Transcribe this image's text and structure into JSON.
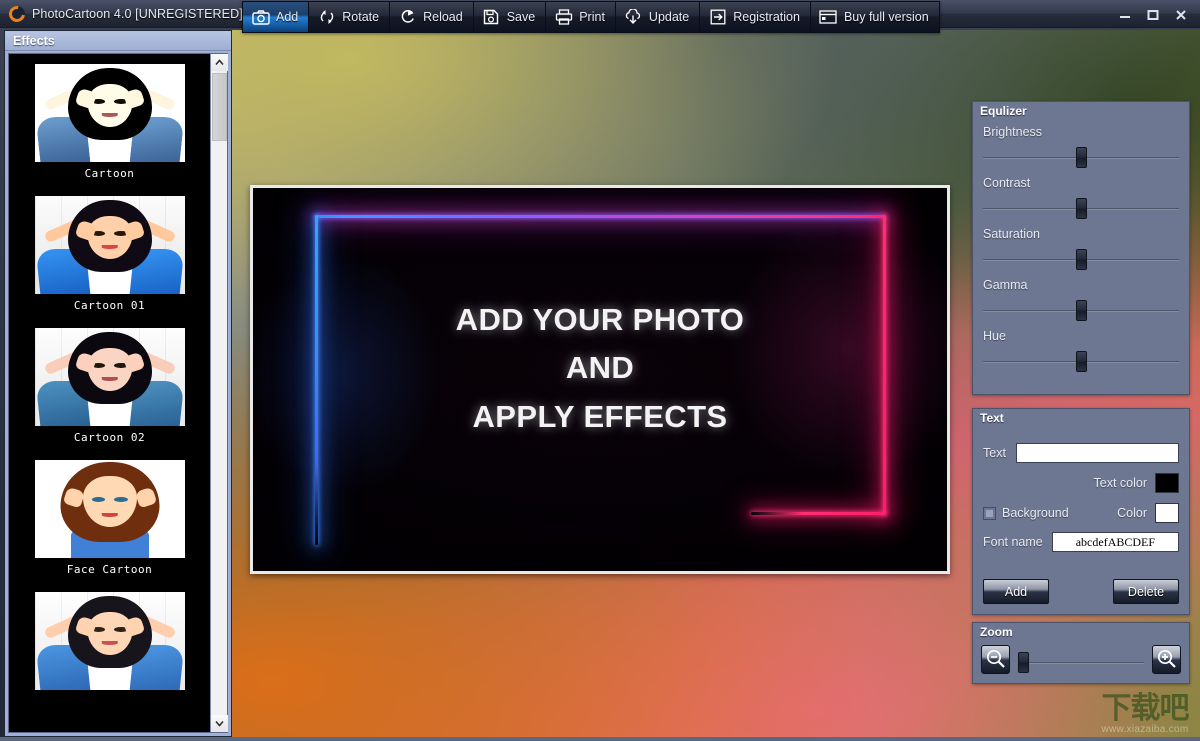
{
  "window": {
    "title": "PhotoCartoon 4.0 [UNREGISTERED]",
    "app_icon": "photocartoon-logo-icon",
    "controls": {
      "minimize": "minimize-icon",
      "maximize": "maximize-icon",
      "close": "close-icon"
    }
  },
  "sidebar": {
    "title": "Effects",
    "items": [
      {
        "label": "Cartoon"
      },
      {
        "label": "Cartoon 01"
      },
      {
        "label": "Cartoon 02"
      },
      {
        "label": "Face Cartoon"
      },
      {
        "label": ""
      }
    ],
    "scroll": {
      "up_arrow": "chevron-up-icon",
      "down_arrow": "chevron-down-icon"
    }
  },
  "toolbar": {
    "buttons": [
      {
        "label": "Add",
        "icon": "camera-icon",
        "active": true
      },
      {
        "label": "Rotate",
        "icon": "rotate-icon",
        "active": false
      },
      {
        "label": "Reload",
        "icon": "reload-icon",
        "active": false
      },
      {
        "label": "Save",
        "icon": "floppy-disk-icon",
        "active": false
      },
      {
        "label": "Print",
        "icon": "printer-icon",
        "active": false
      },
      {
        "label": "Update",
        "icon": "cloud-download-icon",
        "active": false
      },
      {
        "label": "Registration",
        "icon": "arrow-right-box-icon",
        "active": false
      },
      {
        "label": "Buy full version",
        "icon": "window-icon",
        "active": false
      }
    ]
  },
  "canvas": {
    "placeholder_lines": [
      "ADD YOUR PHOTO",
      "AND",
      "APPLY EFFECTS"
    ],
    "neon_colors": {
      "blue": "#3aa0ff",
      "purple": "#a84ff0",
      "pink": "#ff2e73"
    }
  },
  "equalizer": {
    "title": "Equlizer",
    "sliders": [
      {
        "label": "Brightness",
        "value": 50
      },
      {
        "label": "Contrast",
        "value": 50
      },
      {
        "label": "Saturation",
        "value": 50
      },
      {
        "label": "Gamma",
        "value": 50
      },
      {
        "label": "Hue",
        "value": 50
      }
    ]
  },
  "text_panel": {
    "title": "Text",
    "text_label": "Text",
    "text_value": "",
    "text_color_label": "Text color",
    "text_color": "#000000",
    "background_label": "Background",
    "background_checked": false,
    "color_label": "Color",
    "background_color": "#ffffff",
    "font_name_label": "Font name",
    "font_name_value": "abcdefABCDEF",
    "add_button": "Add",
    "delete_button": "Delete"
  },
  "zoom_panel": {
    "title": "Zoom",
    "zoom_out_icon": "magnifier-minus-icon",
    "zoom_in_icon": "magnifier-plus-icon",
    "value": 0
  },
  "watermark": {
    "logo_text": "下载吧",
    "url": "www.xiazaiba.com"
  }
}
